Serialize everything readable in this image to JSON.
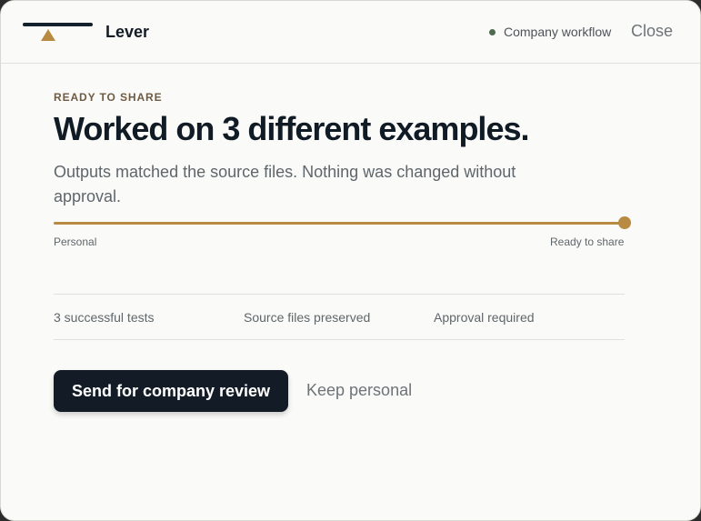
{
  "header": {
    "brand": "Lever",
    "workflow_label": "Company workflow",
    "workflow_status_color": "#4e6b4f",
    "close_label": "Close"
  },
  "main": {
    "eyebrow": "READY TO SHARE",
    "title": "Worked on 3 different examples.",
    "description": "Outputs matched the source files. Nothing was changed without approval.",
    "progress": {
      "value_percent": 100,
      "start_label": "Personal",
      "end_label": "Ready to share",
      "accent_color": "#b98a42"
    },
    "stats": [
      "3 successful tests",
      "Source files preserved",
      "Approval required"
    ],
    "actions": {
      "primary_label": "Send for company review",
      "secondary_label": "Keep personal"
    }
  }
}
